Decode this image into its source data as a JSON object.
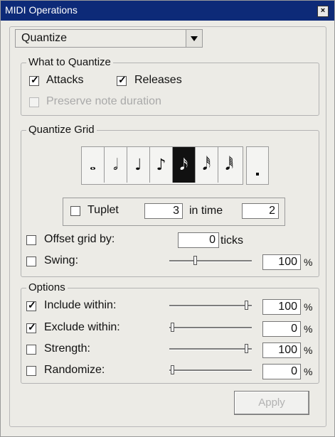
{
  "window": {
    "title": "MIDI Operations",
    "close_icon": "close-icon"
  },
  "operation": {
    "selected": "Quantize"
  },
  "what_to_quantize": {
    "legend": "What to Quantize",
    "attacks": {
      "label": "Attacks",
      "checked": true
    },
    "releases": {
      "label": "Releases",
      "checked": true
    },
    "preserve": {
      "label": "Preserve note duration",
      "checked": false,
      "disabled": true
    }
  },
  "quantize_grid": {
    "legend": "Quantize Grid",
    "notes": [
      {
        "name": "whole-note",
        "glyph": "𝅝"
      },
      {
        "name": "half-note",
        "glyph": "𝅗𝅥"
      },
      {
        "name": "quarter-note",
        "glyph": "♩"
      },
      {
        "name": "eighth-note",
        "glyph": "♪"
      },
      {
        "name": "sixteenth-note",
        "glyph": "𝅘𝅥𝅯",
        "selected": true
      },
      {
        "name": "thirty-second-note",
        "glyph": "𝅘𝅥𝅰"
      },
      {
        "name": "sixty-fourth-note",
        "glyph": "𝅘𝅥𝅱"
      }
    ],
    "dotted": {
      "name": "dotted-note-toggle"
    },
    "tuplet": {
      "label": "Tuplet",
      "checked": false,
      "value": "3",
      "in_time_label": "in time",
      "in_time_value": "2"
    },
    "offset": {
      "label": "Offset grid by:",
      "checked": false,
      "value": "0",
      "unit": "ticks"
    },
    "swing": {
      "label": "Swing:",
      "checked": false,
      "value": "100",
      "unit": "%",
      "level": 0.3
    }
  },
  "options": {
    "legend": "Options",
    "rows": [
      {
        "label": "Include within:",
        "checked": true,
        "value": "100",
        "unit": "%",
        "level": 0.95
      },
      {
        "label": "Exclude within:",
        "checked": true,
        "value": "0",
        "unit": "%",
        "level": 0.02
      },
      {
        "label": "Strength:",
        "checked": false,
        "value": "100",
        "unit": "%",
        "level": 0.95
      },
      {
        "label": "Randomize:",
        "checked": false,
        "value": "0",
        "unit": "%",
        "level": 0.02
      }
    ]
  },
  "apply_label": "Apply"
}
